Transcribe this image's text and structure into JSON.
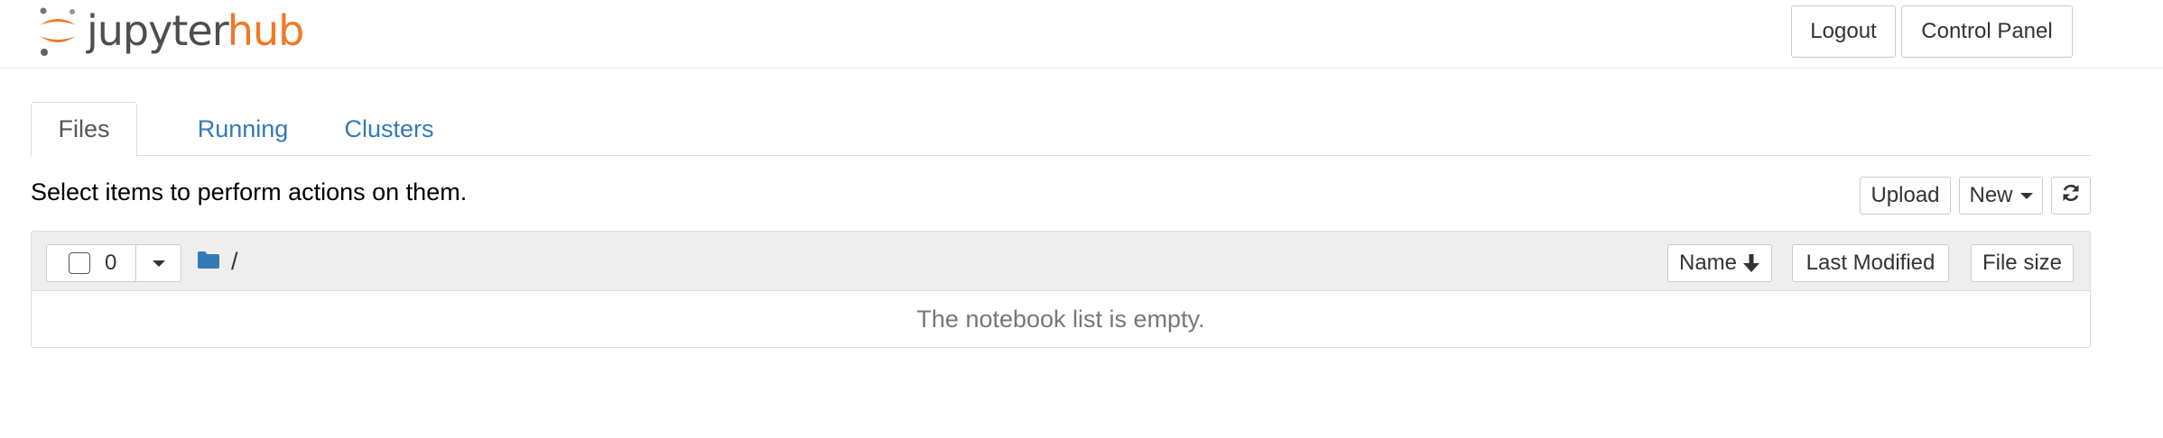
{
  "header": {
    "logo_text_main": "jupyter",
    "logo_text_accent": "hub",
    "logout_label": "Logout",
    "control_panel_label": "Control Panel"
  },
  "tabs": [
    {
      "label": "Files",
      "active": true
    },
    {
      "label": "Running",
      "active": false
    },
    {
      "label": "Clusters",
      "active": false
    }
  ],
  "toolbar": {
    "hint": "Select items to perform actions on them.",
    "upload_label": "Upload",
    "new_label": "New",
    "refresh_icon": "refresh-icon"
  },
  "list": {
    "selected_count": "0",
    "breadcrumb_path": "/",
    "sort_name_label": "Name",
    "sort_modified_label": "Last Modified",
    "sort_size_label": "File size",
    "empty_message": "The notebook list is empty."
  },
  "colors": {
    "link": "#337ab7",
    "jupyter_orange": "#f37726",
    "header_bg": "#eeeeee",
    "folder": "#337ab7"
  }
}
